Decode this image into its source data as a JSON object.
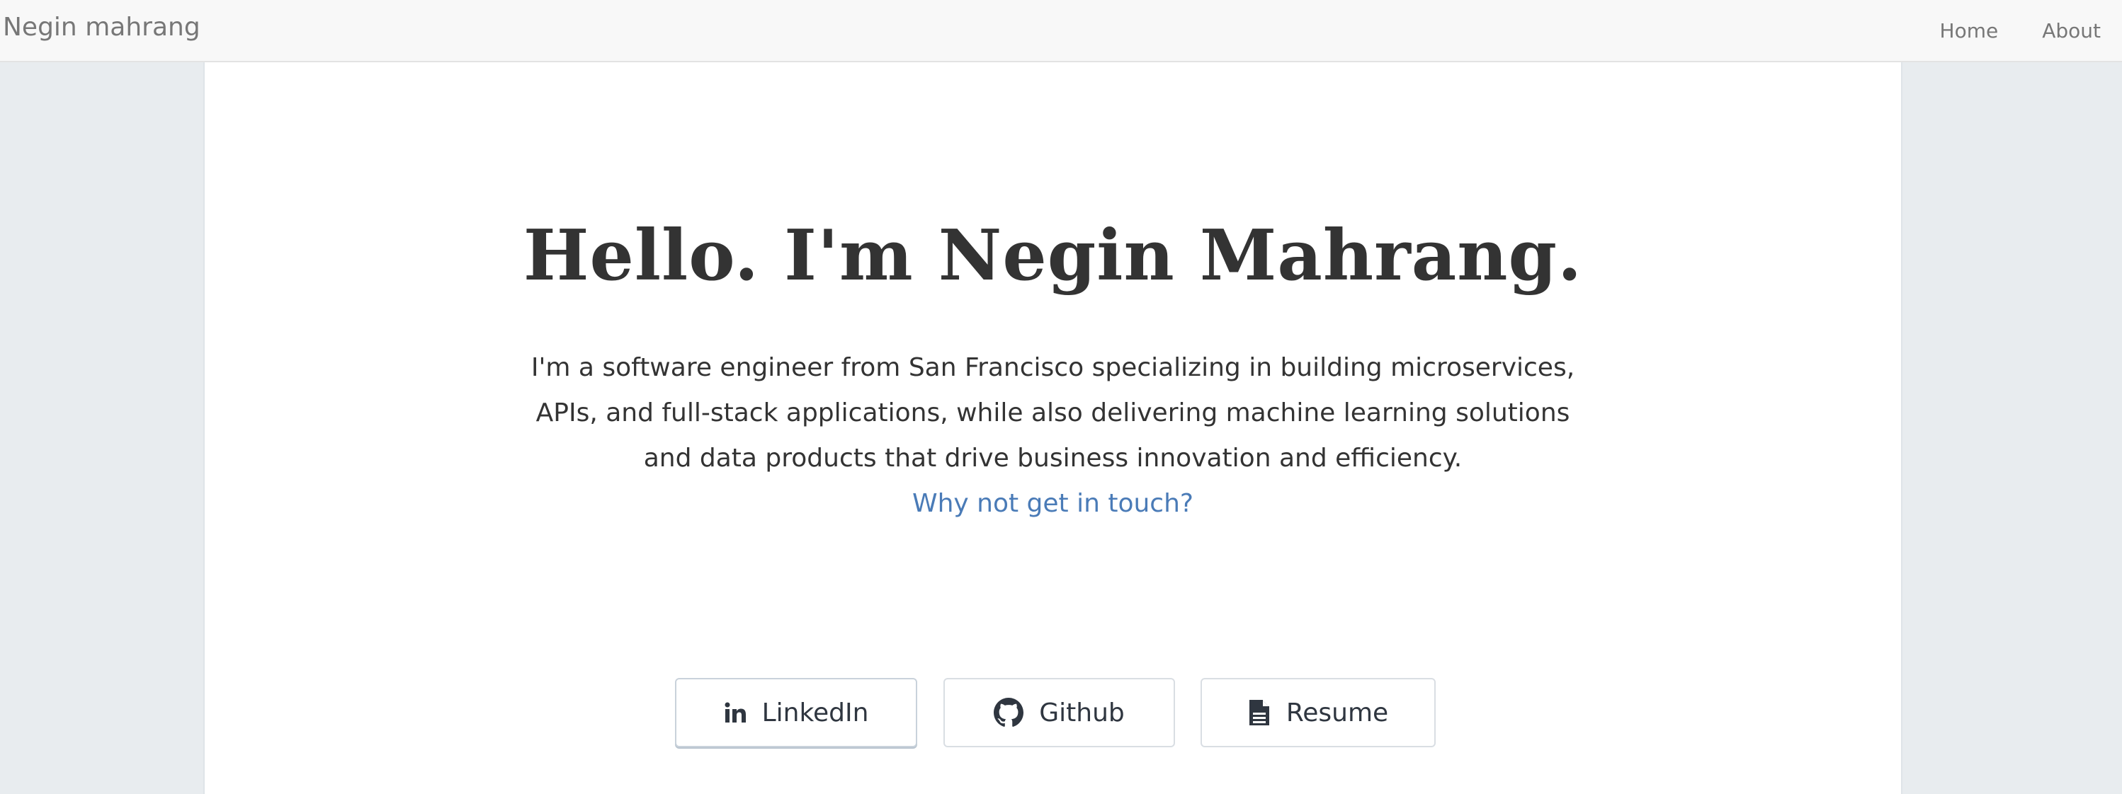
{
  "navbar": {
    "brand": "Negin mahrang",
    "links": [
      {
        "label": "Home"
      },
      {
        "label": "About"
      }
    ]
  },
  "hero": {
    "headline": "Hello. I'm Negin Mahrang.",
    "intro_lines": [
      "I'm a software engineer from San Francisco specializing in building microservices,",
      "APIs, and full-stack applications, while also delivering machine learning solutions",
      "and data products that drive business innovation and efficiency."
    ],
    "contact_link": "Why not get in touch?"
  },
  "buttons": [
    {
      "label": "LinkedIn",
      "icon": "linkedin-icon"
    },
    {
      "label": "Github",
      "icon": "github-icon"
    },
    {
      "label": "Resume",
      "icon": "document-icon"
    }
  ],
  "colors": {
    "page_background": "#e8ecef",
    "navbar_background": "#f8f8f8",
    "link_accent": "#4a7bb7",
    "text": "#333333"
  }
}
